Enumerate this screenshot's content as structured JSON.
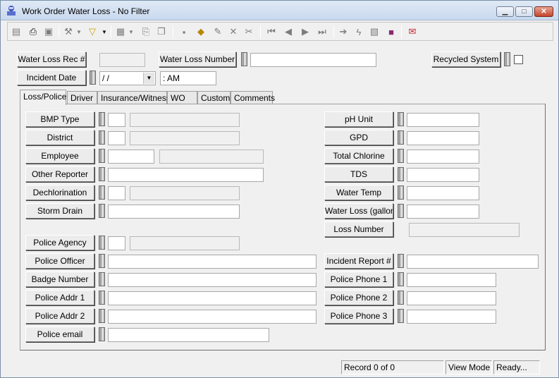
{
  "window": {
    "title": "Work Order Water Loss - No Filter",
    "minimize": "▁",
    "maximize": "□",
    "close": "✕"
  },
  "toolbar": {
    "icons": [
      "list-icon",
      "print-icon",
      "preview-icon",
      "tools-icon",
      "filter-icon",
      "form-icon",
      "export-icon",
      "copy-icon",
      "save-icon",
      "books-icon",
      "edit-icon",
      "delete-icon",
      "cut-icon",
      "first-record-icon",
      "prev-record-icon",
      "next-record-icon",
      "last-record-icon",
      "goto-icon",
      "lightning-icon",
      "attach-icon",
      "notebook-icon",
      "email-icon"
    ]
  },
  "header": {
    "water_loss_rec_label": "Water Loss Rec #",
    "water_loss_rec_value": "",
    "water_loss_number_label": "Water Loss Number",
    "water_loss_number_value": "",
    "recycled_system_label": "Recycled System",
    "incident_date_label": "Incident Date",
    "incident_date_value": " /  /",
    "incident_time_value": "  :  AM"
  },
  "tabs": [
    "Loss/Police",
    "Driver",
    "Insurance/Witness",
    "WO",
    "Custom",
    "Comments"
  ],
  "loss_police": {
    "left": {
      "bmp_type": "BMP Type",
      "district": "District",
      "employee": "Employee",
      "other_reporter": "Other Reporter",
      "dechlorination": "Dechlorination",
      "storm_drain": "Storm Drain",
      "police_agency": "Police Agency",
      "police_officer": "Police Officer",
      "badge_number": "Badge Number",
      "police_addr_1": "Police Addr 1",
      "police_addr_2": "Police Addr 2",
      "police_email": "Police email"
    },
    "right": {
      "ph_unit": "pH Unit",
      "gpd": "GPD",
      "total_chlorine": "Total Chlorine",
      "tds": "TDS",
      "water_temp": "Water Temp",
      "water_loss_gallons": "Water Loss (gallons",
      "loss_number": "Loss Number",
      "incident_report": "Incident Report #",
      "police_phone_1": "Police Phone 1",
      "police_phone_2": "Police Phone 2",
      "police_phone_3": "Police Phone 3"
    }
  },
  "status": {
    "record": "Record 0 of 0",
    "mode": "View Mode",
    "state": "Ready..."
  }
}
